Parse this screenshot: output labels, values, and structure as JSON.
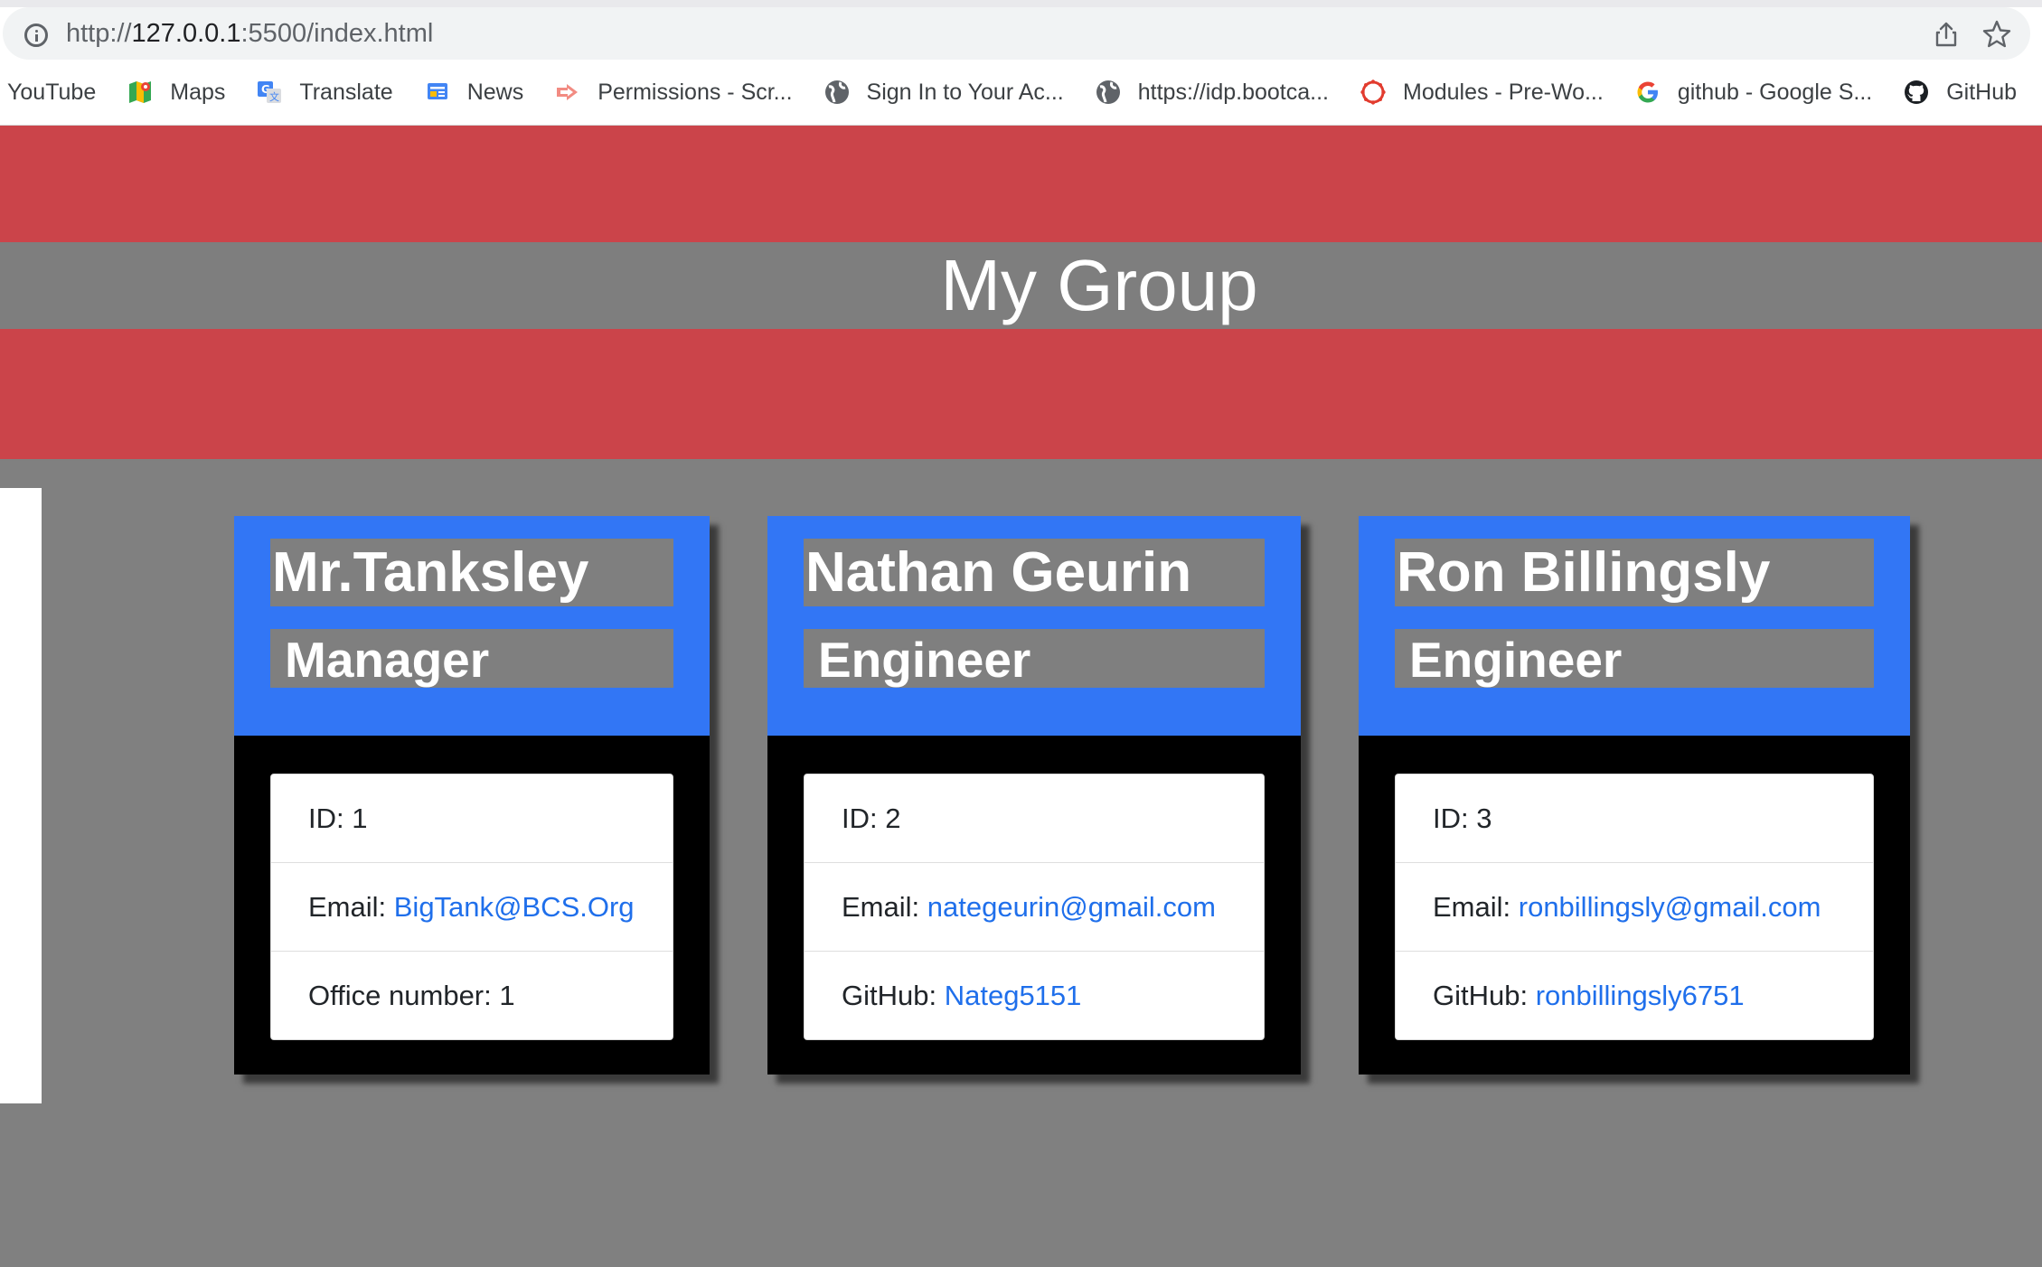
{
  "browser": {
    "url_prefix": "http://",
    "url_host": "127.0.0.1",
    "url_rest": ":5500/index.html",
    "bookmarks": [
      {
        "label": "YouTube",
        "icon": "none"
      },
      {
        "label": "Maps",
        "icon": "maps-icon"
      },
      {
        "label": "Translate",
        "icon": "translate-icon"
      },
      {
        "label": "News",
        "icon": "news-icon"
      },
      {
        "label": "Permissions - Scr...",
        "icon": "permissions-icon"
      },
      {
        "label": "Sign In to Your Ac...",
        "icon": "globe-icon"
      },
      {
        "label": "https://idp.bootca...",
        "icon": "globe-icon"
      },
      {
        "label": "Modules - Pre-Wo...",
        "icon": "canvas-icon"
      },
      {
        "label": "github - Google S...",
        "icon": "google-icon"
      },
      {
        "label": "GitHub",
        "icon": "github-icon"
      }
    ]
  },
  "page": {
    "title": "My Group",
    "colors": {
      "banner": "#cb444a",
      "background": "#808080",
      "card_header": "#3276f5",
      "card_body": "#000000",
      "link": "#1f6feb"
    }
  },
  "cards": [
    {
      "name": "Mr.Tanksley",
      "role": "Manager",
      "id_label": "ID: ",
      "id_value": "1",
      "email_label": "Email: ",
      "email": "BigTank@BCS.Org",
      "extra_label": "Office number: ",
      "extra_value": "1"
    },
    {
      "name": "Nathan Geurin",
      "role": "Engineer",
      "id_label": "ID: ",
      "id_value": "2",
      "email_label": "Email: ",
      "email": "nategeurin@gmail.com",
      "extra_label": "GitHub: ",
      "extra_value": "Nateg5151"
    },
    {
      "name": "Ron Billingsly",
      "role": "Engineer",
      "id_label": "ID: ",
      "id_value": "3",
      "email_label": "Email: ",
      "email": "ronbillingsly@gmail.com",
      "extra_label": "GitHub: ",
      "extra_value": "ronbillingsly6751"
    }
  ]
}
